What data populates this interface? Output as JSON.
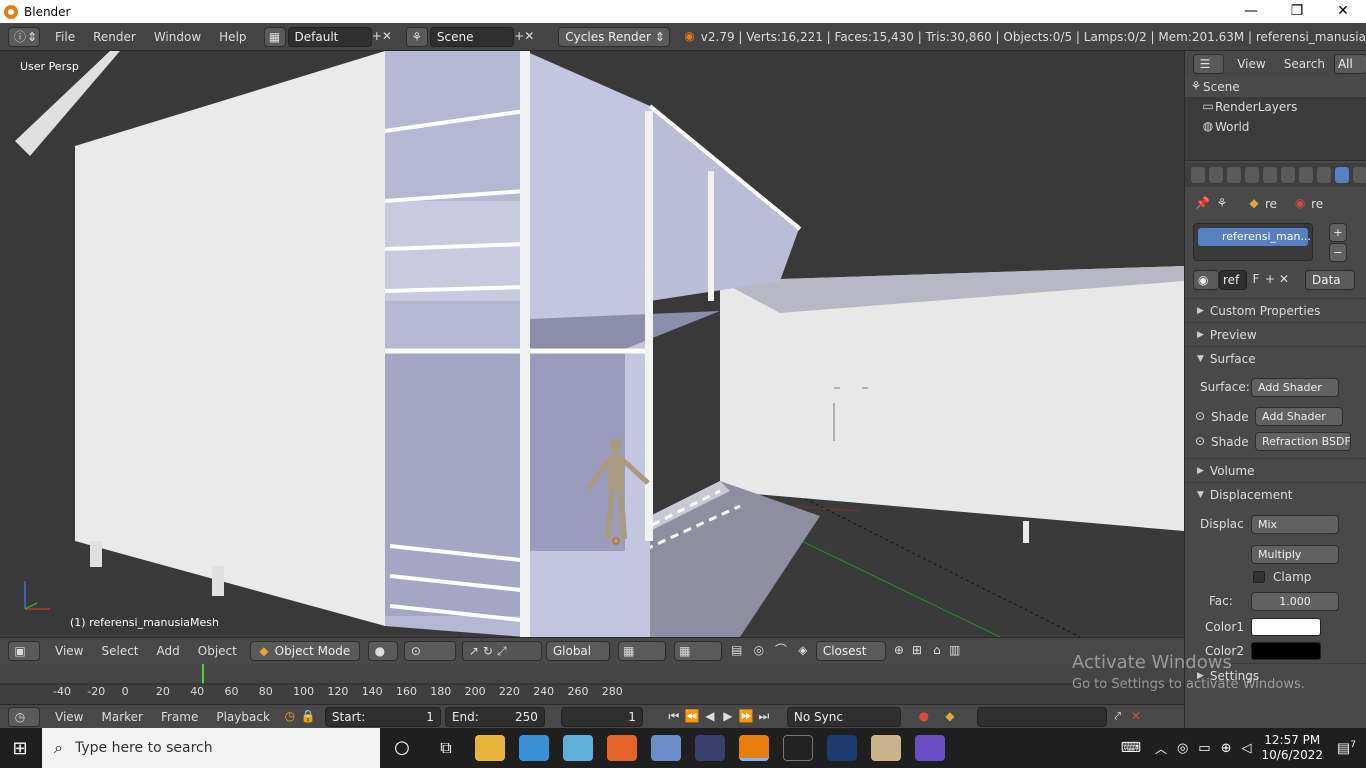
{
  "window": {
    "title": "Blender",
    "minimize": "—",
    "restore": "❐",
    "close": "✕"
  },
  "topbar": {
    "menus": [
      "File",
      "Render",
      "Window",
      "Help"
    ],
    "layout": "Default",
    "scene": "Scene",
    "engine": "Cycles Render",
    "stats": "v2.79 | Verts:16,221 | Faces:15,430 | Tris:30,860 | Objects:0/5 | Lamps:0/2 | Mem:201.63M | referensi_manusia"
  },
  "viewport": {
    "view_label": "User Persp",
    "object_label": "(1) referensi_manusiaMesh"
  },
  "view_toolbar": {
    "menus": [
      "View",
      "Select",
      "Add",
      "Object"
    ],
    "mode": "Object Mode",
    "orientation": "Global",
    "snap": "Closest"
  },
  "timeline": {
    "ticks": [
      "-40",
      "-20",
      "0",
      "20",
      "40",
      "60",
      "80",
      "100",
      "120",
      "140",
      "160",
      "180",
      "200",
      "220",
      "240",
      "260",
      "280"
    ],
    "menus": [
      "View",
      "Marker",
      "Frame",
      "Playback"
    ],
    "start_label": "Start:",
    "start": "1",
    "end_label": "End:",
    "end": "250",
    "current": "1",
    "sync": "No Sync"
  },
  "outliner": {
    "menus": [
      "View",
      "Search"
    ],
    "filter": "All Sc",
    "items": [
      "Scene",
      "RenderLayers",
      "World"
    ]
  },
  "properties": {
    "breadcrumb": [
      "re",
      "re"
    ],
    "material_slot": "referensi_man...",
    "material_name": "ref",
    "f_label": "F",
    "data": "Data",
    "panels": {
      "custom": "Custom Properties",
      "preview": "Preview",
      "surface": "Surface",
      "volume": "Volume",
      "displacement": "Displacement",
      "settings": "Settings"
    },
    "surface_label": "Surface:",
    "surface_value": "Add Shader",
    "shade1_label": "Shade",
    "shade1_value": "Add Shader",
    "shade2_label": "Shade",
    "shade2_value": "Refraction BSDF",
    "displac_label": "Displac",
    "displac_value": "Mix",
    "blend": "Multiply",
    "clamp": "Clamp",
    "fac_label": "Fac:",
    "fac": "1.000",
    "color1": "Color1",
    "color2": "Color2"
  },
  "watermark": {
    "line1": "Activate Windows",
    "line2": "Go to Settings to activate Windows."
  },
  "taskbar": {
    "search_placeholder": "Type here to search",
    "time": "12:57 PM",
    "date": "10/6/2022",
    "notifications": "7"
  }
}
